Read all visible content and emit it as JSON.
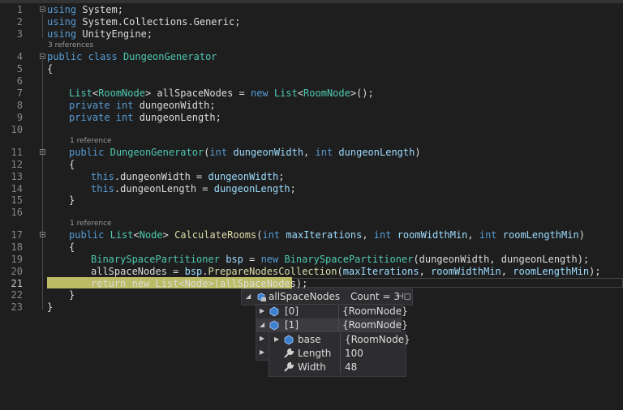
{
  "editor": {
    "line_numbers": [
      "1",
      "2",
      "3",
      "4",
      "5",
      "6",
      "7",
      "8",
      "9",
      "10",
      "11",
      "12",
      "13",
      "14",
      "15",
      "16",
      "17",
      "18",
      "19",
      "20",
      "21",
      "22",
      "23"
    ],
    "lens": {
      "class_refs": "3 references",
      "ctor_refs": "1 reference",
      "method_refs": "1 reference"
    },
    "lines": {
      "l1": [
        [
          "kw",
          "using"
        ],
        [
          "pl",
          " System;"
        ]
      ],
      "l2": [
        [
          "kw",
          "using"
        ],
        [
          "pl",
          " System.Collections.Generic;"
        ]
      ],
      "l3": [
        [
          "kw",
          "using"
        ],
        [
          "pl",
          " UnityEngine;"
        ]
      ],
      "l4": [
        [
          "kw",
          "public class"
        ],
        [
          "pl",
          " "
        ],
        [
          "ty",
          "DungeonGenerator"
        ]
      ],
      "l6": [
        [
          "pl",
          "{"
        ]
      ],
      "l7": [
        [
          "ty",
          "List"
        ],
        [
          "pl",
          "<"
        ],
        [
          "ty",
          "RoomNode"
        ],
        [
          "pl",
          "> allSpaceNodes = "
        ],
        [
          "kw",
          "new"
        ],
        [
          "pl",
          " "
        ],
        [
          "ty",
          "List"
        ],
        [
          "pl",
          "<"
        ],
        [
          "ty",
          "RoomNode"
        ],
        [
          "pl",
          ">();"
        ]
      ],
      "l8": [
        [
          "kw",
          "private int"
        ],
        [
          "pl",
          " dungeonWidth;"
        ]
      ],
      "l9": [
        [
          "kw",
          "private int"
        ],
        [
          "pl",
          " dungeonLength;"
        ]
      ],
      "l11": [
        [
          "kw",
          "public"
        ],
        [
          "pl",
          " "
        ],
        [
          "ty",
          "DungeonGenerator"
        ],
        [
          "pl",
          "("
        ],
        [
          "kw",
          "int"
        ],
        [
          "pl",
          " "
        ],
        [
          "var",
          "dungeonWidth"
        ],
        [
          "pl",
          ", "
        ],
        [
          "kw",
          "int"
        ],
        [
          "pl",
          " "
        ],
        [
          "var",
          "dungeonLength"
        ],
        [
          "pl",
          ")"
        ]
      ],
      "l12": [
        [
          "pl",
          "{"
        ]
      ],
      "l13": [
        [
          "kw",
          "this"
        ],
        [
          "pl",
          ".dungeonWidth = "
        ],
        [
          "var",
          "dungeonWidth"
        ],
        [
          "pl",
          ";"
        ]
      ],
      "l14": [
        [
          "kw",
          "this"
        ],
        [
          "pl",
          ".dungeonLength = "
        ],
        [
          "var",
          "dungeonLength"
        ],
        [
          "pl",
          ";"
        ]
      ],
      "l15": [
        [
          "pl",
          "}"
        ]
      ],
      "l17": [
        [
          "kw",
          "public"
        ],
        [
          "pl",
          " "
        ],
        [
          "ty",
          "List"
        ],
        [
          "pl",
          "<"
        ],
        [
          "ty",
          "Node"
        ],
        [
          "pl",
          "> "
        ],
        [
          "fn",
          "CalculateRooms"
        ],
        [
          "pl",
          "("
        ],
        [
          "kw",
          "int"
        ],
        [
          "pl",
          " "
        ],
        [
          "var",
          "maxIterations"
        ],
        [
          "pl",
          ", "
        ],
        [
          "kw",
          "int"
        ],
        [
          "pl",
          " "
        ],
        [
          "var",
          "roomWidthMin"
        ],
        [
          "pl",
          ", "
        ],
        [
          "kw",
          "int"
        ],
        [
          "pl",
          " "
        ],
        [
          "var",
          "roomLengthMin"
        ],
        [
          "pl",
          ")"
        ]
      ],
      "l18": [
        [
          "pl",
          "{"
        ]
      ],
      "l19": [
        [
          "ty",
          "BinarySpacePartitioner"
        ],
        [
          "pl",
          " "
        ],
        [
          "var",
          "bsp"
        ],
        [
          "pl",
          " = "
        ],
        [
          "kw",
          "new"
        ],
        [
          "pl",
          " "
        ],
        [
          "ty",
          "BinarySpacePartitioner"
        ],
        [
          "pl",
          "(dungeonWidth, dungeonLength);"
        ]
      ],
      "l20": [
        [
          "pl",
          "allSpaceNodes = "
        ],
        [
          "var",
          "bsp"
        ],
        [
          "pl",
          "."
        ],
        [
          "fn",
          "PrepareNodesCollection"
        ],
        [
          "pl",
          "("
        ],
        [
          "var",
          "maxIterations"
        ],
        [
          "pl",
          ", "
        ],
        [
          "var",
          "roomWidthMin"
        ],
        [
          "pl",
          ", "
        ],
        [
          "var",
          "roomLengthMin"
        ],
        [
          "pl",
          ");"
        ]
      ],
      "l21": [
        [
          "pl",
          "return new List<Node>(allSpaceNodes);"
        ]
      ],
      "l22": [
        [
          "pl",
          "}"
        ]
      ],
      "l23": [
        [
          "pl",
          "}"
        ]
      ]
    }
  },
  "datatip": {
    "header": {
      "name": "allSpaceNodes",
      "value": "Count = 3"
    },
    "items": [
      {
        "name": "[0]",
        "value": "{RoomNode}"
      },
      {
        "name": "[1]",
        "value": "{RoomNode}"
      }
    ],
    "sub": [
      {
        "name": "base",
        "value": "{RoomNode}"
      },
      {
        "name": "Length",
        "value": "100"
      },
      {
        "name": "Width",
        "value": "48"
      }
    ]
  }
}
